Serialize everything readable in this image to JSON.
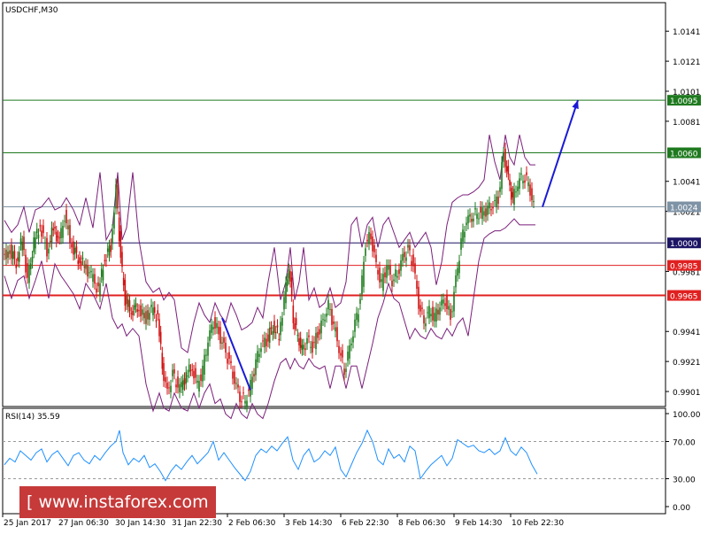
{
  "chart_data": [
    {
      "type": "candlestick",
      "title": "USDCHF,M30",
      "ylim": [
        0.9891,
        1.016
      ],
      "yticks": [
        1.0141,
        1.0121,
        1.0101,
        1.0081,
        1.0041,
        1.0021,
        0.9981,
        0.9941,
        0.9921,
        0.9901
      ],
      "x_tick_labels": [
        "25 Jan 2017",
        "27 Jan 06:30",
        "30 Jan 14:30",
        "31 Jan 22:30",
        "2 Feb 06:30",
        "3 Feb 14:30",
        "6 Feb 22:30",
        "8 Feb 06:30",
        "9 Feb 14:30",
        "10 Feb 22:30"
      ],
      "levels": [
        {
          "value": "1.0095",
          "color": "#1f7a1f",
          "label_bg": "#1f7a1f"
        },
        {
          "value": "1.0060",
          "color": "#1f7a1f",
          "label_bg": "#1f7a1f"
        },
        {
          "value": "1.0024",
          "color": "#7f93a6",
          "label_bg": "#7f93a6"
        },
        {
          "value": "1.0000",
          "color": "#1b1464",
          "label_bg": "#1b1464"
        },
        {
          "value": "0.9985",
          "color": "#e02020",
          "label_bg": "#e02020"
        },
        {
          "value": "0.9965",
          "color": "#e02020",
          "label_bg": "#e02020"
        }
      ],
      "price_series": [
        [
          0,
          0.999
        ],
        [
          8,
          0.9995
        ],
        [
          15,
          0.9987
        ],
        [
          22,
          1.0003
        ],
        [
          28,
          0.9975
        ],
        [
          35,
          1.0
        ],
        [
          42,
          1.0012
        ],
        [
          50,
          0.9995
        ],
        [
          57,
          1.001
        ],
        [
          64,
          1.0
        ],
        [
          70,
          1.0018
        ],
        [
          78,
          0.9998
        ],
        [
          85,
          0.999
        ],
        [
          92,
          0.9985
        ],
        [
          100,
          0.9978
        ],
        [
          108,
          0.9968
        ],
        [
          115,
          0.999
        ],
        [
          122,
          0.9998
        ],
        [
          128,
          1.0035
        ],
        [
          133,
          0.999
        ],
        [
          138,
          0.9962
        ],
        [
          145,
          0.9955
        ],
        [
          152,
          0.9958
        ],
        [
          160,
          0.995
        ],
        [
          168,
          0.9955
        ],
        [
          175,
          0.995
        ],
        [
          180,
          0.9918
        ],
        [
          186,
          0.99
        ],
        [
          192,
          0.9912
        ],
        [
          200,
          0.9902
        ],
        [
          207,
          0.9912
        ],
        [
          214,
          0.9918
        ],
        [
          220,
          0.9905
        ],
        [
          226,
          0.9915
        ],
        [
          232,
          0.9935
        ],
        [
          238,
          0.9948
        ],
        [
          244,
          0.994
        ],
        [
          250,
          0.993
        ],
        [
          256,
          0.992
        ],
        [
          262,
          0.9908
        ],
        [
          268,
          0.9898
        ],
        [
          274,
          0.9895
        ],
        [
          280,
          0.9905
        ],
        [
          286,
          0.992
        ],
        [
          292,
          0.9932
        ],
        [
          298,
          0.9935
        ],
        [
          305,
          0.9945
        ],
        [
          312,
          0.9938
        ],
        [
          318,
          0.9962
        ],
        [
          323,
          0.9985
        ],
        [
          328,
          0.995
        ],
        [
          333,
          0.9938
        ],
        [
          338,
          0.9928
        ],
        [
          344,
          0.9935
        ],
        [
          350,
          0.993
        ],
        [
          356,
          0.994
        ],
        [
          362,
          0.9948
        ],
        [
          368,
          0.9958
        ],
        [
          374,
          0.9945
        ],
        [
          380,
          0.993
        ],
        [
          386,
          0.9915
        ],
        [
          392,
          0.993
        ],
        [
          398,
          0.9945
        ],
        [
          404,
          0.9962
        ],
        [
          410,
          1.0
        ],
        [
          416,
          1.0005
        ],
        [
          422,
          0.9985
        ],
        [
          428,
          0.9972
        ],
        [
          434,
          0.9985
        ],
        [
          440,
          0.9975
        ],
        [
          446,
          0.998
        ],
        [
          452,
          0.999
        ],
        [
          458,
          0.9995
        ],
        [
          464,
          0.9985
        ],
        [
          470,
          0.996
        ],
        [
          476,
          0.9948
        ],
        [
          482,
          0.9955
        ],
        [
          488,
          0.995
        ],
        [
          494,
          0.9958
        ],
        [
          500,
          0.9962
        ],
        [
          506,
          0.995
        ],
        [
          512,
          0.9975
        ],
        [
          518,
          1.0
        ],
        [
          524,
          1.0015
        ],
        [
          530,
          1.0018
        ],
        [
          536,
          1.002
        ],
        [
          542,
          1.002
        ],
        [
          548,
          1.0022
        ],
        [
          554,
          1.0025
        ],
        [
          560,
          1.003
        ],
        [
          566,
          1.006
        ],
        [
          571,
          1.0042
        ],
        [
          576,
          1.0028
        ],
        [
          582,
          1.004
        ],
        [
          588,
          1.0045
        ],
        [
          594,
          1.004
        ],
        [
          600,
          1.0024
        ]
      ],
      "arrow": {
        "from": [
          608,
          1.0024
        ],
        "to": [
          648,
          1.0095
        ],
        "color": "#1a1ad6"
      },
      "downline": {
        "from": [
          246,
          0.995
        ],
        "to": [
          278,
          0.9902
        ],
        "color": "#1a1ad6"
      }
    },
    {
      "type": "line",
      "title": "RSI(14) 35.59",
      "ylim": [
        0,
        100
      ],
      "yticks": [
        100.0,
        70.0,
        30.0,
        0.0
      ],
      "ytick_labels": [
        "100.00",
        "70.00",
        "30.00",
        "0.00"
      ],
      "levels": [
        70,
        30
      ],
      "series": [
        [
          0,
          45
        ],
        [
          6,
          52
        ],
        [
          12,
          48
        ],
        [
          18,
          60
        ],
        [
          24,
          55
        ],
        [
          30,
          50
        ],
        [
          36,
          58
        ],
        [
          42,
          62
        ],
        [
          48,
          48
        ],
        [
          54,
          56
        ],
        [
          60,
          60
        ],
        [
          66,
          52
        ],
        [
          72,
          44
        ],
        [
          78,
          55
        ],
        [
          84,
          58
        ],
        [
          90,
          50
        ],
        [
          96,
          46
        ],
        [
          102,
          55
        ],
        [
          108,
          50
        ],
        [
          114,
          58
        ],
        [
          120,
          65
        ],
        [
          126,
          70
        ],
        [
          130,
          82
        ],
        [
          134,
          58
        ],
        [
          140,
          45
        ],
        [
          146,
          52
        ],
        [
          152,
          48
        ],
        [
          158,
          55
        ],
        [
          164,
          42
        ],
        [
          170,
          46
        ],
        [
          176,
          38
        ],
        [
          182,
          28
        ],
        [
          188,
          38
        ],
        [
          194,
          45
        ],
        [
          200,
          40
        ],
        [
          206,
          48
        ],
        [
          212,
          55
        ],
        [
          218,
          46
        ],
        [
          224,
          52
        ],
        [
          230,
          58
        ],
        [
          236,
          70
        ],
        [
          242,
          50
        ],
        [
          248,
          58
        ],
        [
          254,
          50
        ],
        [
          260,
          42
        ],
        [
          266,
          35
        ],
        [
          272,
          28
        ],
        [
          278,
          38
        ],
        [
          284,
          55
        ],
        [
          290,
          62
        ],
        [
          296,
          58
        ],
        [
          302,
          65
        ],
        [
          308,
          60
        ],
        [
          314,
          68
        ],
        [
          320,
          75
        ],
        [
          326,
          50
        ],
        [
          332,
          40
        ],
        [
          338,
          55
        ],
        [
          344,
          62
        ],
        [
          350,
          48
        ],
        [
          356,
          52
        ],
        [
          362,
          60
        ],
        [
          368,
          55
        ],
        [
          374,
          64
        ],
        [
          380,
          40
        ],
        [
          386,
          32
        ],
        [
          392,
          45
        ],
        [
          398,
          58
        ],
        [
          404,
          68
        ],
        [
          410,
          82
        ],
        [
          416,
          70
        ],
        [
          422,
          50
        ],
        [
          428,
          45
        ],
        [
          434,
          62
        ],
        [
          440,
          52
        ],
        [
          446,
          56
        ],
        [
          452,
          48
        ],
        [
          458,
          65
        ],
        [
          464,
          60
        ],
        [
          470,
          30
        ],
        [
          476,
          38
        ],
        [
          482,
          45
        ],
        [
          488,
          50
        ],
        [
          494,
          55
        ],
        [
          500,
          44
        ],
        [
          506,
          52
        ],
        [
          512,
          72
        ],
        [
          518,
          68
        ],
        [
          524,
          64
        ],
        [
          530,
          66
        ],
        [
          536,
          60
        ],
        [
          542,
          58
        ],
        [
          548,
          62
        ],
        [
          554,
          56
        ],
        [
          560,
          60
        ],
        [
          566,
          74
        ],
        [
          572,
          60
        ],
        [
          578,
          55
        ],
        [
          584,
          64
        ],
        [
          590,
          58
        ],
        [
          596,
          45
        ],
        [
          602,
          35
        ]
      ]
    }
  ],
  "watermark": "[ www.instaforex.com ]"
}
